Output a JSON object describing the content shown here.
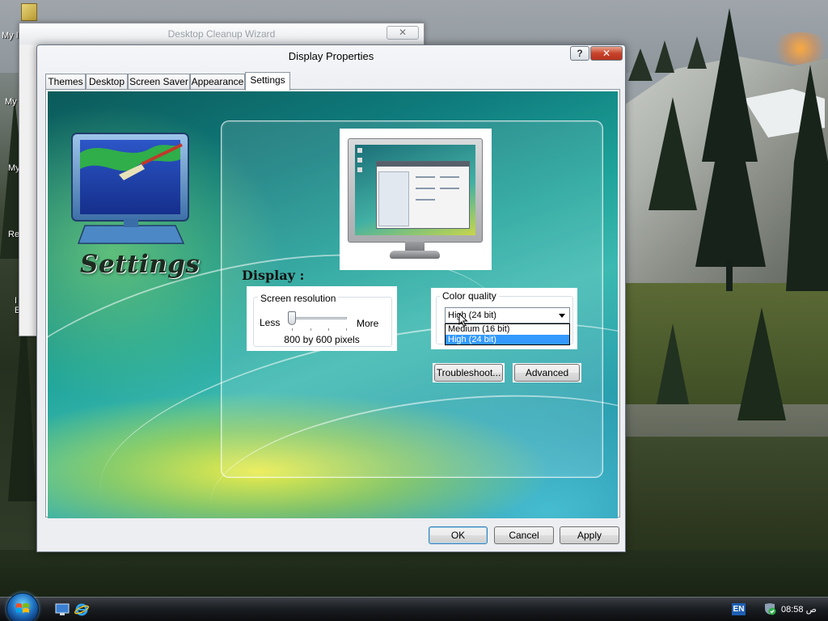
{
  "desktop": {
    "icon_labels": [
      "My I",
      "My",
      "My",
      "Re",
      "I",
      "E"
    ]
  },
  "wizard": {
    "title": "Desktop Cleanup Wizard",
    "close_glyph": "✕"
  },
  "dialog": {
    "title": "Display Properties",
    "help_glyph": "?",
    "close_glyph": "✕",
    "tabs": [
      {
        "label": "Themes",
        "active": false
      },
      {
        "label": "Desktop",
        "active": false
      },
      {
        "label": "Screen Saver",
        "active": false
      },
      {
        "label": "Appearance",
        "active": false
      },
      {
        "label": "Settings",
        "active": true
      }
    ],
    "header_word": "Settings",
    "display_label": "Display :",
    "screen_resolution": {
      "legend": "Screen resolution",
      "less_label": "Less",
      "more_label": "More",
      "value_text": "800 by 600 pixels",
      "slider_position": 0.0
    },
    "color_quality": {
      "legend": "Color quality",
      "selected": "High (24 bit)",
      "options": [
        "Medium (16 bit)",
        "High (24 bit)"
      ],
      "highlighted_index": 1
    },
    "buttons": {
      "troubleshoot": "Troubleshoot...",
      "advanced": "Advanced",
      "ok": "OK",
      "cancel": "Cancel",
      "apply": "Apply"
    }
  },
  "taskbar": {
    "language": "EN",
    "clock": "ص 08:58",
    "icons": [
      "start-orb-icon",
      "show-desktop-icon",
      "internet-explorer-icon",
      "security-shield-icon"
    ]
  },
  "colors": {
    "accent": "#3399ff",
    "close_red": "#c8432a",
    "taskbar": "#1c1f23"
  }
}
